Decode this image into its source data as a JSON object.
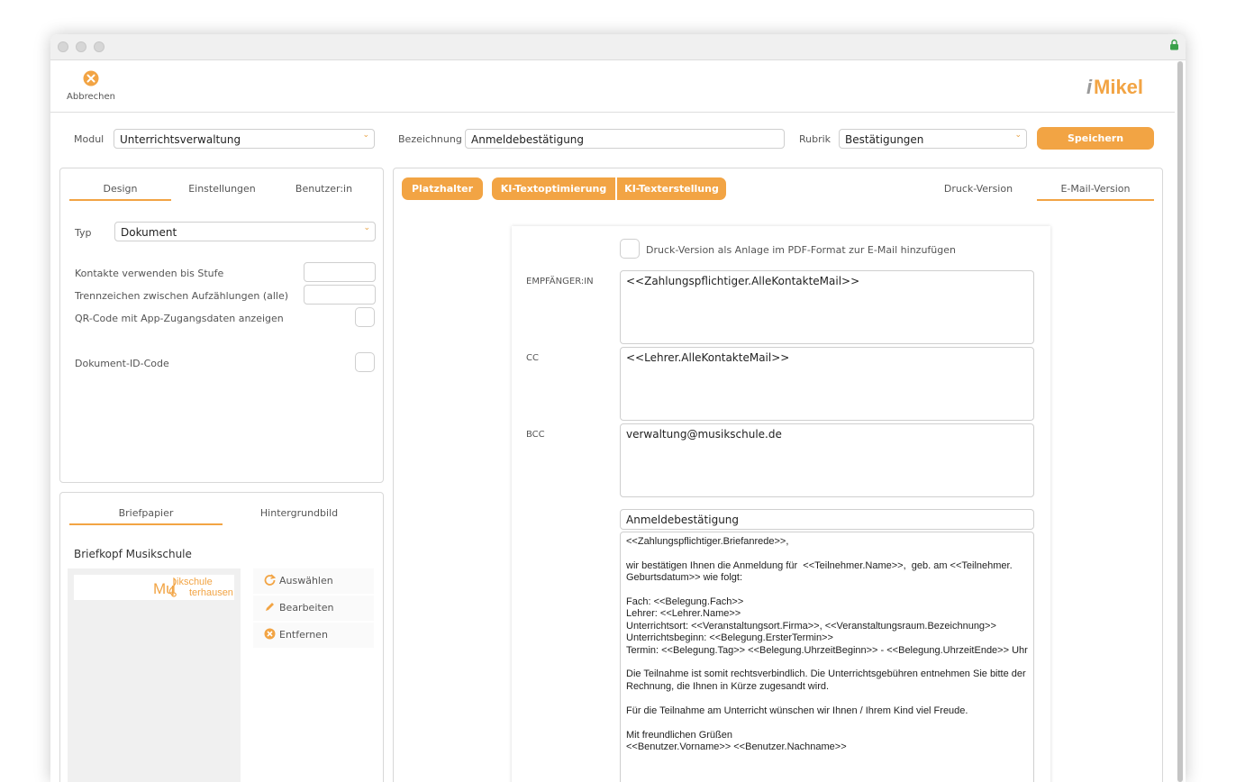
{
  "toolbar": {
    "cancel_label": "Abbrechen",
    "logo_text": "iMikel"
  },
  "form": {
    "modul_label": "Modul",
    "modul_value": "Unterrichtsverwaltung",
    "bezeichnung_label": "Bezeichnung",
    "bezeichnung_value": "Anmeldebestätigung",
    "rubrik_label": "Rubrik",
    "rubrik_value": "Bestätigungen",
    "save_label": "Speichern"
  },
  "left_panel": {
    "tabs": [
      "Design",
      "Einstellungen",
      "Benutzer:in"
    ],
    "typ_label": "Typ",
    "typ_value": "Dokument",
    "kontakte_label": "Kontakte verwenden bis Stufe",
    "trennzeichen_label": "Trennzeichen zwischen Aufzählungen (alle)",
    "qr_label": "QR-Code mit App-Zugangsdaten anzeigen",
    "docid_label": "Dokument-ID-Code"
  },
  "briefpapier": {
    "tabs": [
      "Briefpapier",
      "Hintergrundbild"
    ],
    "title": "Briefkopf Musikschule",
    "logo_prefix": "Mu",
    "logo_line1": "ikschule",
    "logo_line2": "terhausen",
    "actions": [
      "Auswählen",
      "Bearbeiten",
      "Entfernen"
    ]
  },
  "editor": {
    "buttons": [
      "Platzhalter",
      "KI-Textoptimierung",
      "KI-Texterstellung"
    ],
    "version_tabs": [
      "Druck-Version",
      "E-Mail-Version"
    ],
    "attach_label": "Druck-Version als Anlage im PDF-Format zur E-Mail hinzufügen",
    "recipient_label": "EMPFÄNGER:IN",
    "recipient_value": "<<Zahlungspflichtiger.AlleKontakteMail>>",
    "cc_label": "CC",
    "cc_value": "<<Lehrer.AlleKontakteMail>>",
    "bcc_label": "BCC",
    "bcc_value": "verwaltung@musikschule.de",
    "subject": "Anmeldebestätigung",
    "body": "<<Zahlungspflichtiger.Briefanrede>>,\n\nwir bestätigen Ihnen die Anmeldung für  <<Teilnehmer.Name>>,  geb. am <<Teilnehmer.\nGeburtsdatum>> wie folgt:\n\nFach: <<Belegung.Fach>>\nLehrer: <<Lehrer.Name>>\nUnterrichtsort: <<Veranstaltungsort.Firma>>, <<Veranstaltungsraum.Bezeichnung>>\nUnterrichtsbeginn: <<Belegung.ErsterTermin>>\nTermin: <<Belegung.Tag>> <<Belegung.UhrzeitBeginn>> - <<Belegung.UhrzeitEnde>> Uhr\n\nDie Teilnahme ist somit rechtsverbindlich. Die Unterrichtsgebühren entnehmen Sie bitte der\nRechnung, die Ihnen in Kürze zugesandt wird.\n\nFür die Teilnahme am Unterricht wünschen wir Ihnen / Ihrem Kind viel Freude.\n\nMit freundlichen Grüßen\n<<Benutzer.Vorname>> <<Benutzer.Nachname>>"
  },
  "colors": {
    "accent": "#f2a444",
    "border": "#cfcfcf"
  }
}
